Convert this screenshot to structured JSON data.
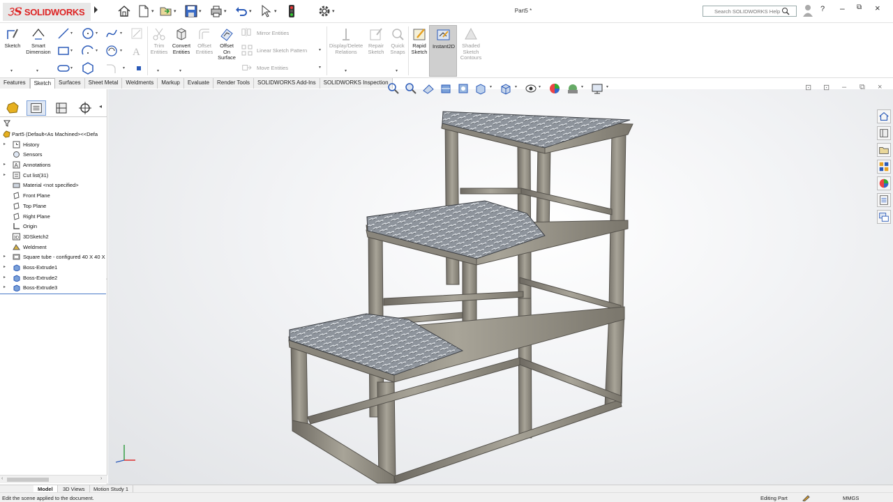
{
  "app": {
    "brand": "SOLIDWORKS",
    "doc_title": "Part5 *"
  },
  "help": {
    "placeholder": "Search SOLIDWORKS Help"
  },
  "ribbon": {
    "sketch": "Sketch",
    "smart_dimension": [
      "Smart",
      "Dimension"
    ],
    "trim": [
      "Trim",
      "Entities"
    ],
    "convert": [
      "Convert",
      "Entities"
    ],
    "offset": [
      "Offset",
      "Entities"
    ],
    "offset_surface": [
      "Offset",
      "On",
      "Surface"
    ],
    "mirror": "Mirror Entities",
    "linear_pattern": "Linear Sketch Pattern",
    "move": "Move Entities",
    "display_delete": [
      "Display/Delete",
      "Relations"
    ],
    "repair": [
      "Repair",
      "Sketch"
    ],
    "quick_snaps": [
      "Quick",
      "Snaps"
    ],
    "rapid_sketch": [
      "Rapid",
      "Sketch"
    ],
    "instant2d": "Instant2D",
    "shaded_contours": [
      "Shaded",
      "Sketch",
      "Contours"
    ]
  },
  "tabs": [
    "Features",
    "Sketch",
    "Surfaces",
    "Sheet Metal",
    "Weldments",
    "Markup",
    "Evaluate",
    "Render Tools",
    "SOLIDWORKS Add-Ins",
    "SOLIDWORKS Inspection"
  ],
  "active_tab": "Sketch",
  "tree": {
    "root": "Part5  (Default<As Machined><<Defa",
    "items": [
      {
        "label": "History",
        "icon": "history-icon",
        "expandable": true
      },
      {
        "label": "Sensors",
        "icon": "sensor-icon",
        "expandable": false
      },
      {
        "label": "Annotations",
        "icon": "annotation-icon",
        "expandable": true
      },
      {
        "label": "Cut list(31)",
        "icon": "cutlist-icon",
        "expandable": true
      },
      {
        "label": "Material <not specified>",
        "icon": "material-icon",
        "expandable": false
      },
      {
        "label": "Front Plane",
        "icon": "plane-icon",
        "expandable": false
      },
      {
        "label": "Top Plane",
        "icon": "plane-icon",
        "expandable": false
      },
      {
        "label": "Right Plane",
        "icon": "plane-icon",
        "expandable": false
      },
      {
        "label": "Origin",
        "icon": "origin-icon",
        "expandable": false
      },
      {
        "label": "3DSketch2",
        "icon": "sketch3d-icon",
        "expandable": false
      },
      {
        "label": "Weldment",
        "icon": "weldment-icon",
        "expandable": false
      },
      {
        "label": "Square tube - configured 40 X 40 X",
        "icon": "structural-member-icon",
        "expandable": true
      },
      {
        "label": "Boss-Extrude1",
        "icon": "extrude-icon",
        "expandable": true
      },
      {
        "label": "Boss-Extrude2",
        "icon": "extrude-icon",
        "expandable": true
      },
      {
        "label": "Boss-Extrude3",
        "icon": "extrude-icon",
        "expandable": true
      }
    ]
  },
  "bottom_tabs": [
    "Model",
    "3D Views",
    "Motion Study 1"
  ],
  "status": {
    "message": "Edit the scene applied to the document.",
    "mode": "Editing Part",
    "units": "MMGS"
  },
  "colors": {
    "brand": "#d22222",
    "selection": "#4a7ac8",
    "frame": "#8e8a80",
    "plate": "#9aa0a8"
  }
}
